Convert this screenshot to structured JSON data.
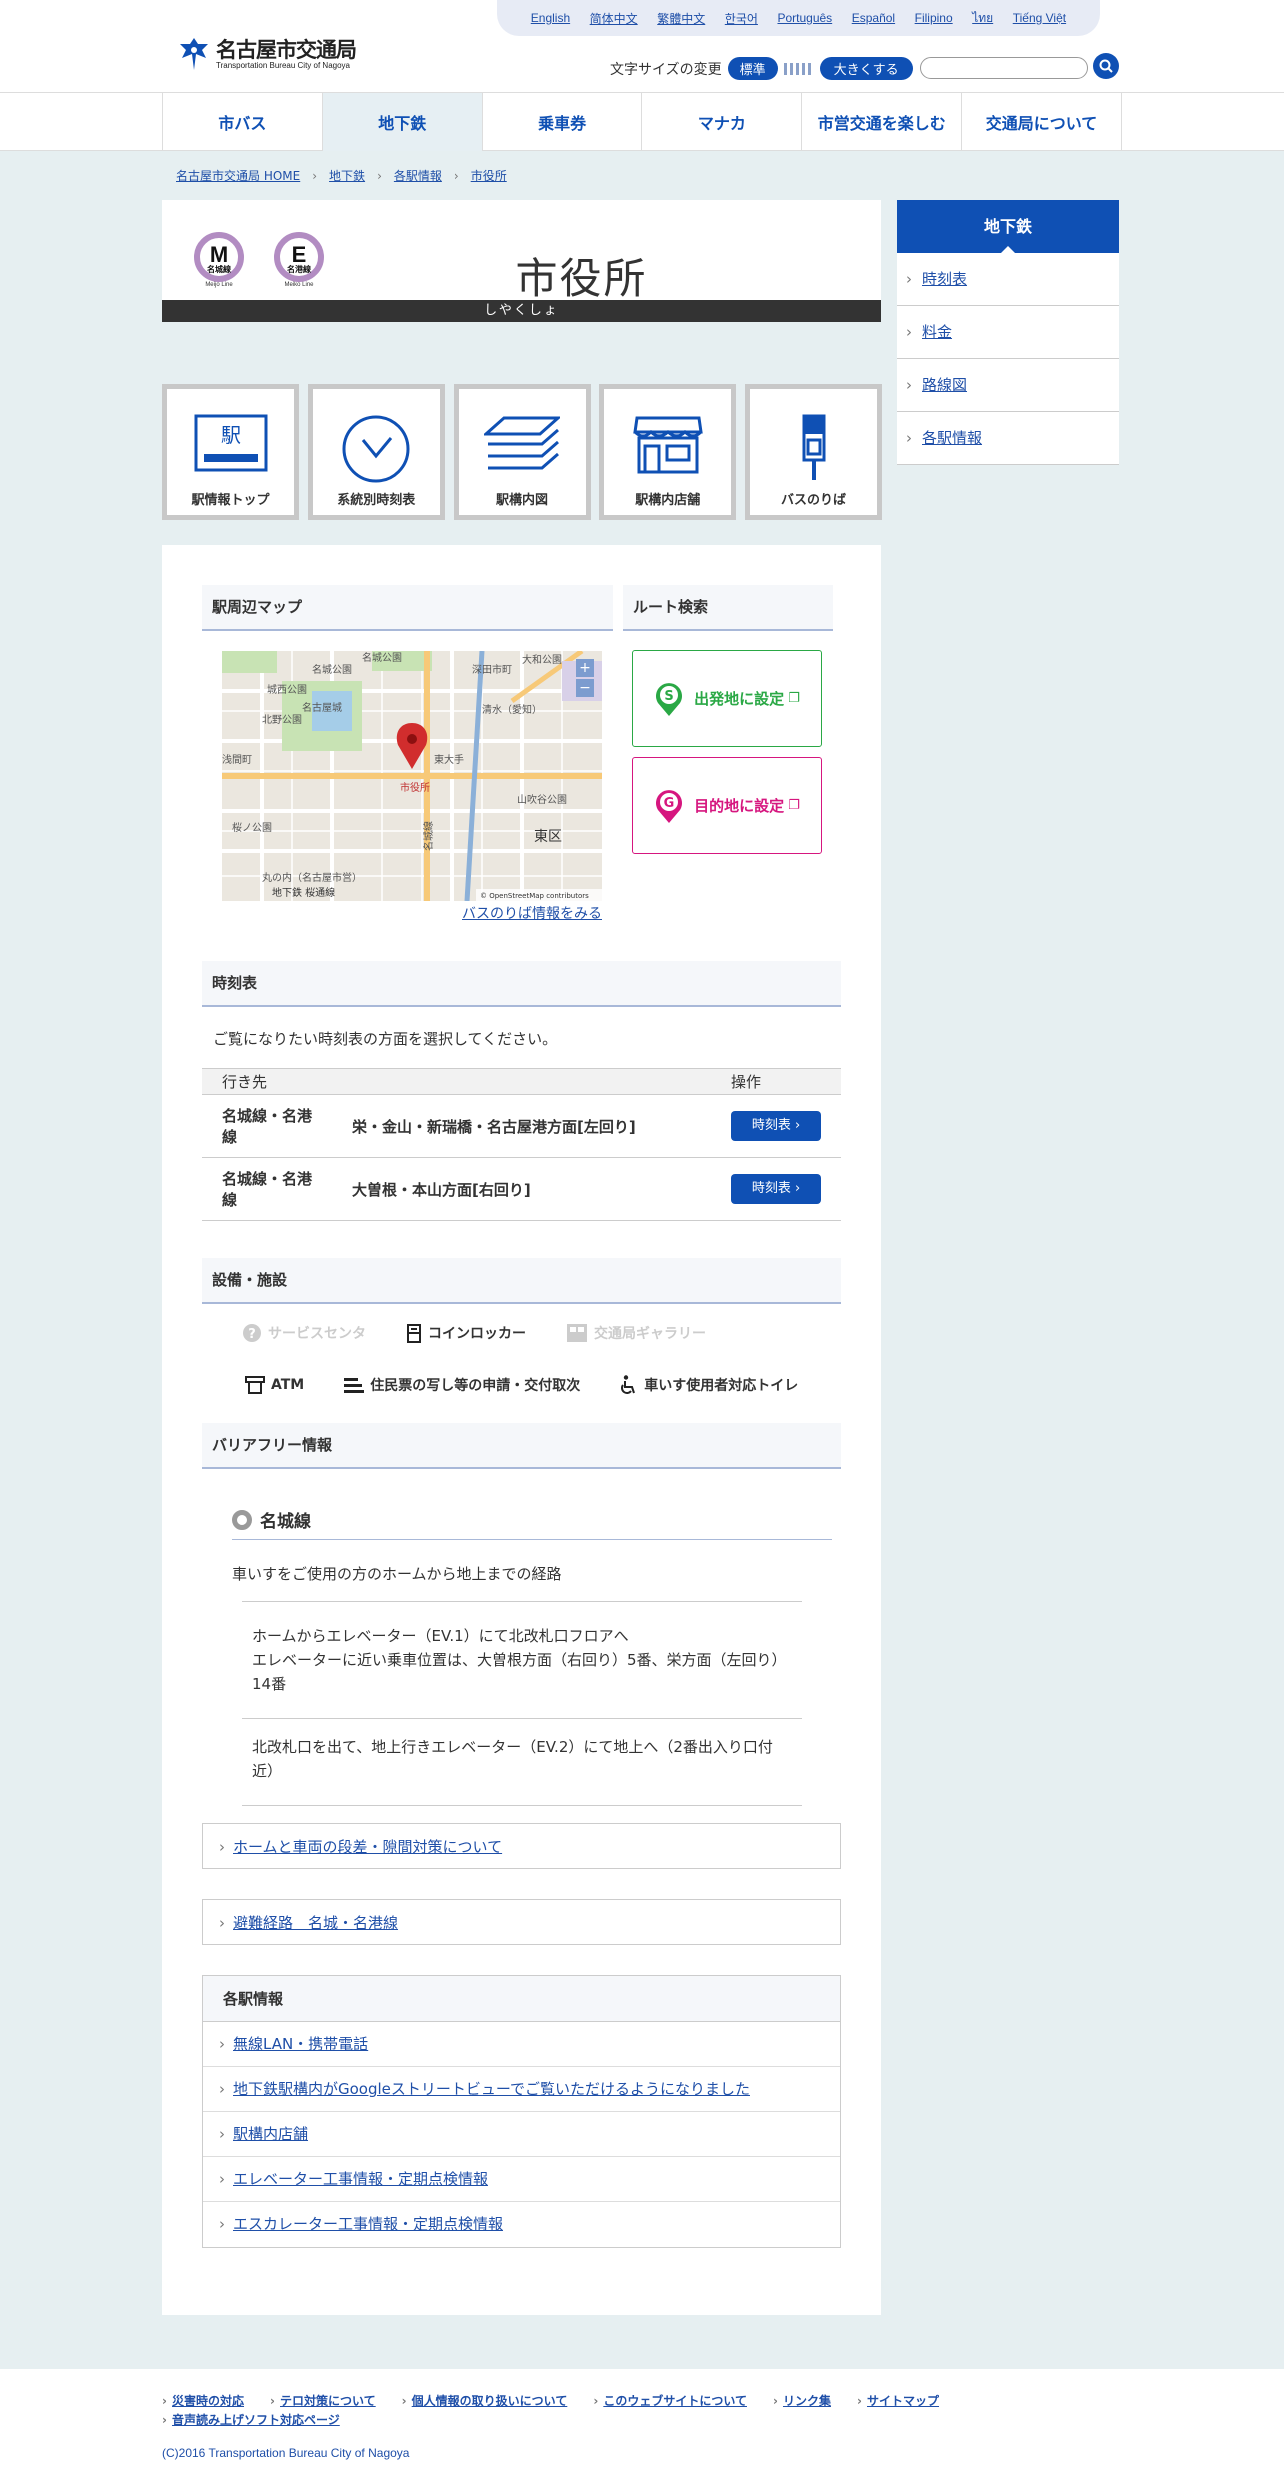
{
  "languages": [
    "English",
    "简体中文",
    "繁體中文",
    "한국어",
    "Português",
    "Español",
    "Filipino",
    "ไทย",
    "Tiếng Việt"
  ],
  "logo": {
    "ja": "名古屋市交通局",
    "en": "Transportation Bureau City of Nagoya"
  },
  "font_size": {
    "label": "文字サイズの変更",
    "standard": "標準",
    "large": "大きくする"
  },
  "search": {
    "placeholder": ""
  },
  "gnav": [
    "市バス",
    "地下鉄",
    "乗車券",
    "マナカ",
    "市営交通を楽しむ",
    "交通局について"
  ],
  "breadcrumb": [
    "名古屋市交通局 HOME",
    "地下鉄",
    "各駅情報",
    "市役所"
  ],
  "station": {
    "name": "市役所",
    "kana": "しやくしょ",
    "lines": [
      {
        "letter": "M",
        "ja": "名城線",
        "en": "Meijo Line"
      },
      {
        "letter": "E",
        "ja": "名港線",
        "en": "Meiko Line"
      }
    ]
  },
  "tiles": [
    "駅情報トップ",
    "系統別時刻表",
    "駅構内図",
    "駅構内店舗",
    "バスのりば"
  ],
  "sidenav": {
    "title": "地下鉄",
    "items": [
      "時刻表",
      "料金",
      "路線図",
      "各駅情報"
    ]
  },
  "map_section": {
    "title": "駅周辺マップ",
    "route_title": "ルート検索",
    "bus_link": "バスのりば情報をみる",
    "route_from": "出発地に設定",
    "route_to": "目的地に設定",
    "map_labels": [
      "名城公園",
      "城西公園",
      "名城公園",
      "北野公園",
      "清水（愛知）",
      "市役所",
      "東大手",
      "浅間町",
      "山吹谷公園",
      "東区",
      "丸の内（名古屋市営）",
      "地下鉄 桜通線",
      "大和公園",
      "深田市町",
      "桜ノ公園",
      "名古屋城",
      "名城線"
    ],
    "attribution": "© OpenStreetMap contributors"
  },
  "timetable": {
    "title": "時刻表",
    "desc": "ご覧になりたい時刻表の方面を選択してください。",
    "col_dest": "行き先",
    "col_op": "操作",
    "rows": [
      {
        "line": "名城線・名港線",
        "dir": "栄・金山・新瑞橋・名古屋港方面[左回り]",
        "btn": "時刻表"
      },
      {
        "line": "名城線・名港線",
        "dir": "大曽根・本山方面[右回り]",
        "btn": "時刻表"
      }
    ]
  },
  "facilities": {
    "title": "設備・施設",
    "row1": [
      {
        "label": "サービスセンタ",
        "icon": "question-icon",
        "active": false
      },
      {
        "label": "コインロッカー",
        "icon": "locker-icon",
        "active": true
      },
      {
        "label": "交通局ギャラリー",
        "icon": "gallery-icon",
        "active": false
      }
    ],
    "row2": [
      {
        "label": "ATM",
        "icon": "atm-icon",
        "active": true
      },
      {
        "label": "住民票の写し等の申請・交付取次",
        "icon": "document-icon",
        "active": true
      },
      {
        "label": "車いす使用者対応トイレ",
        "icon": "wheelchair-icon",
        "active": true
      }
    ]
  },
  "barrier_free": {
    "title": "バリアフリー情報",
    "line": "名城線",
    "sub": "車いすをご使用の方のホームから地上までの経路",
    "steps": [
      "ホームからエレベーター（EV.1）にて北改札口フロアへ\nエレベーターに近い乗車位置は、大曽根方面（右回り）5番、栄方面（左回り）14番",
      "北改札口を出て、地上行きエレベーター（EV.2）にて地上へ（2番出入り口付近）"
    ]
  },
  "links": [
    "ホームと車両の段差・隙間対策について",
    "避難経路　名城・名港線"
  ],
  "station_info": {
    "title": "各駅情報",
    "items": [
      "無線LAN・携帯電話",
      "地下鉄駅構内がGoogleストリートビューでご覧いただけるようになりました",
      "駅構内店舗",
      "エレベーター工事情報・定期点検情報",
      "エスカレーター工事情報・定期点検情報"
    ]
  },
  "footer": {
    "links": [
      "災害時の対応",
      "テロ対策について",
      "個人情報の取り扱いについて",
      "このウェブサイトについて",
      "リンク集",
      "サイトマップ",
      "音声読み上げソフト対応ページ"
    ],
    "copyright": "(C)2016 Transportation Bureau City of Nagoya"
  },
  "colors": {
    "brand": "#0f50b4",
    "line_purple": "#b28cc2",
    "start_green": "#2aa845",
    "goal_magenta": "#d6167f"
  }
}
